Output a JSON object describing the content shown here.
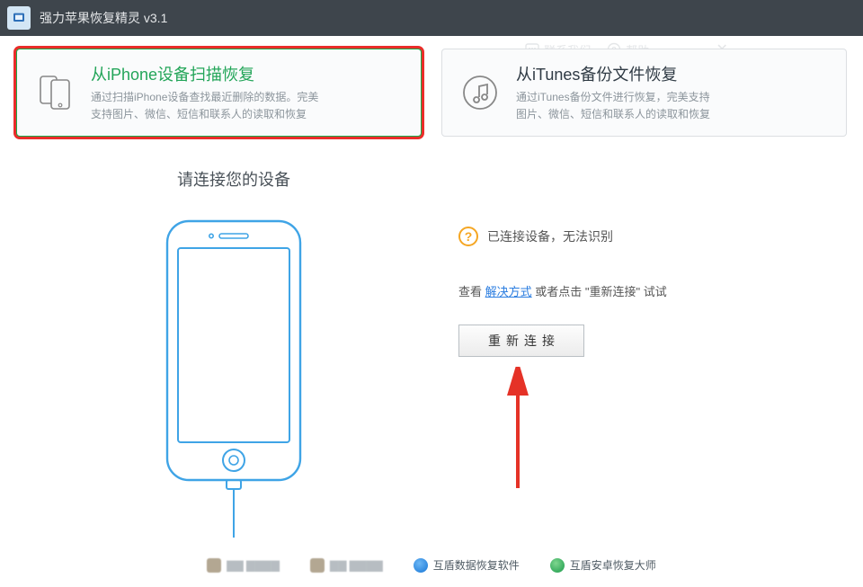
{
  "titlebar": {
    "title": "强力苹果恢复精灵 v3.1",
    "contact": "联系我们",
    "help": "帮助"
  },
  "modes": {
    "iphone": {
      "title": "从iPhone设备扫描恢复",
      "desc1": "通过扫描iPhone设备查找最近删除的数据。完美",
      "desc2": "支持图片、微信、短信和联系人的读取和恢复"
    },
    "itunes": {
      "title": "从iTunes备份文件恢复",
      "desc1": "通过iTunes备份文件进行恢复，完美支持",
      "desc2": "图片、微信、短信和联系人的读取和恢复"
    }
  },
  "main": {
    "connect_prompt": "请连接您的设备",
    "status_text": "已连接设备，无法识别",
    "hint_before": "查看 ",
    "hint_link": "解决方式",
    "hint_after": " 或者点击 \"重新连接\" 试试",
    "reconnect": "重新连接"
  },
  "footer": {
    "link1": "互盾数据恢复软件",
    "link2": "互盾安卓恢复大师"
  }
}
